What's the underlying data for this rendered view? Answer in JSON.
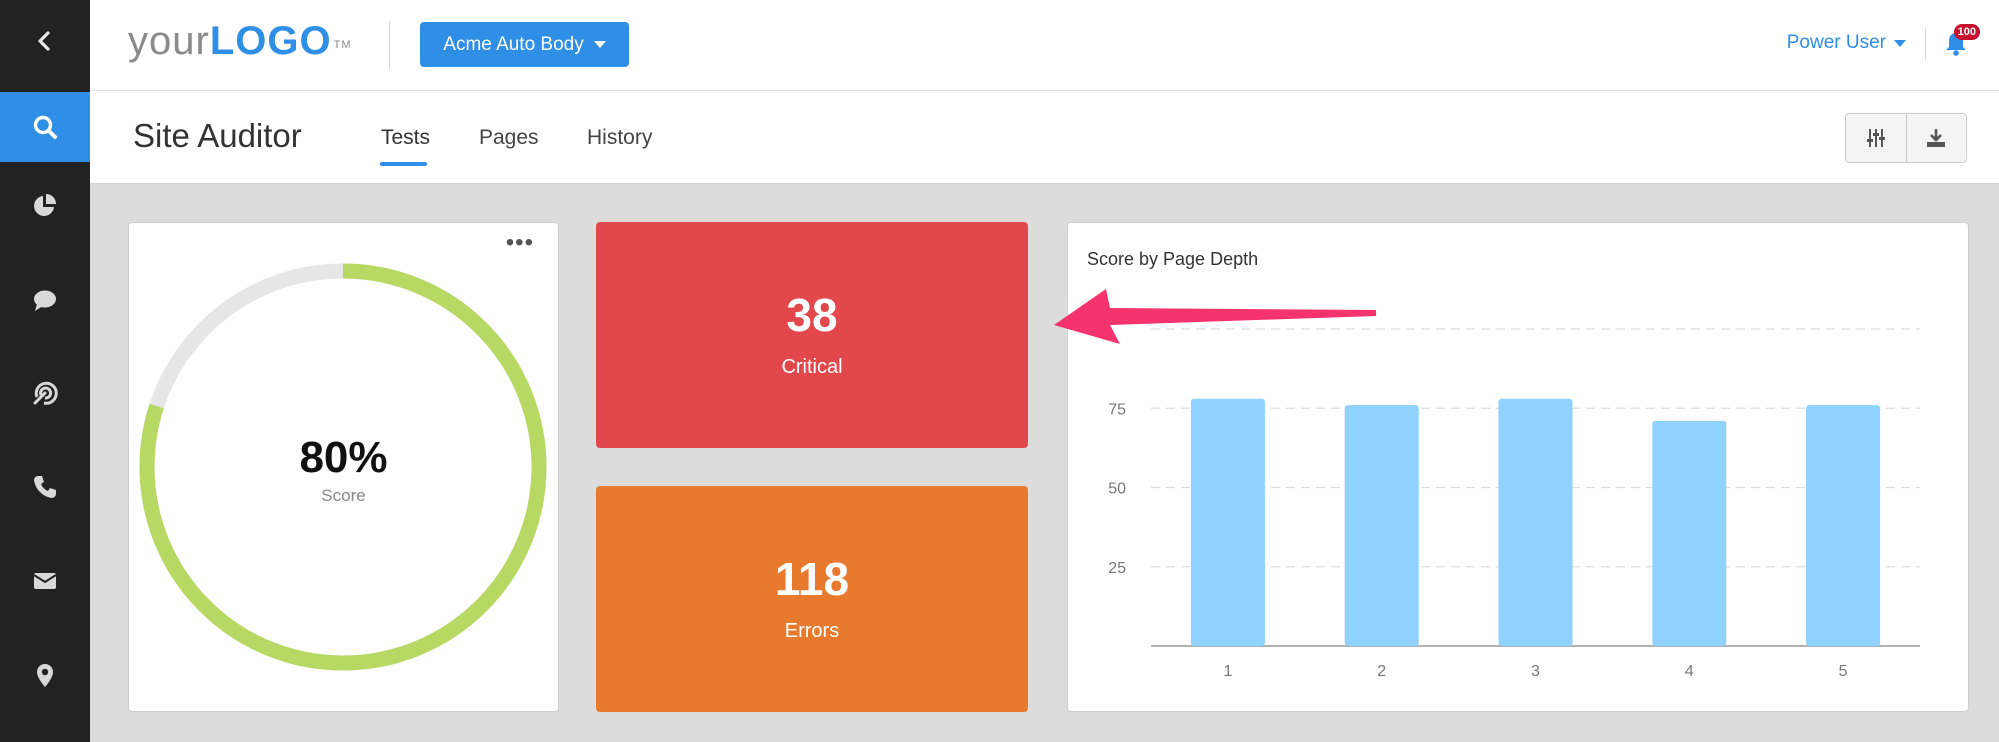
{
  "sidebar": {
    "items": [
      {
        "icon": "chevron-left-icon"
      },
      {
        "icon": "search-icon",
        "active": true
      },
      {
        "icon": "pie-chart-icon"
      },
      {
        "icon": "chat-bubble-icon"
      },
      {
        "icon": "target-icon"
      },
      {
        "icon": "phone-icon"
      },
      {
        "icon": "envelope-icon"
      },
      {
        "icon": "map-pin-icon"
      }
    ]
  },
  "header": {
    "logo_your": "your",
    "logo_brand": "LOGO",
    "logo_tm": "TM",
    "account_label": "Acme Auto Body",
    "user_label": "Power User",
    "notification_count": "100"
  },
  "subheader": {
    "title": "Site Auditor",
    "tabs": [
      {
        "label": "Tests",
        "active": true
      },
      {
        "label": "Pages"
      },
      {
        "label": "History"
      }
    ],
    "tools": [
      "sliders-icon",
      "download-icon"
    ]
  },
  "score_card": {
    "value": "80%",
    "label": "Score",
    "fraction": 0.8,
    "more_label": "•••"
  },
  "critical_card": {
    "value": "38",
    "label": "Critical",
    "color": "#e2474b"
  },
  "errors_card": {
    "value": "118",
    "label": "Errors",
    "color": "#e87a2e"
  },
  "chart_data": {
    "type": "bar",
    "title": "Score by Page Depth",
    "categories": [
      "1",
      "2",
      "3",
      "4",
      "5"
    ],
    "values": [
      78,
      76,
      78,
      71,
      76
    ],
    "yticks": [
      25,
      50,
      75
    ],
    "ylim": [
      0,
      100
    ],
    "grid": true,
    "bar_color": "#8ed2fd"
  },
  "colors": {
    "accent": "#2f8ee5",
    "gauge": "#b7d964",
    "gauge_track": "#e6e6e6",
    "annotation_arrow": "#f5336e"
  }
}
